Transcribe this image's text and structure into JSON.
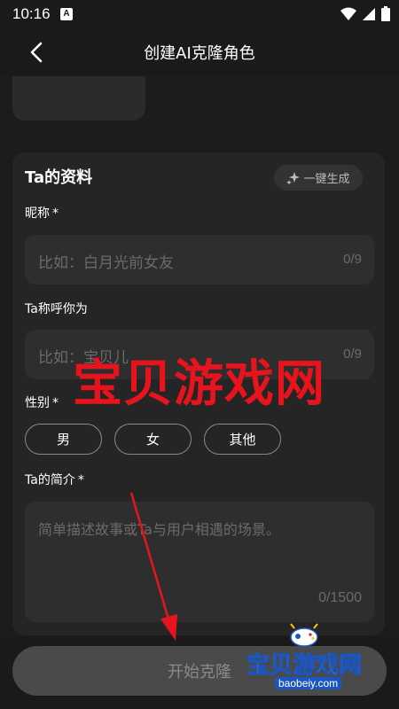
{
  "status_bar": {
    "time": "10:16",
    "notification_badge": "A"
  },
  "header": {
    "title": "创建AI克隆角色"
  },
  "profile": {
    "section_title": "Ta的资料",
    "ai_generate_label": "一键生成",
    "nickname": {
      "label": "昵称",
      "required_mark": "*",
      "placeholder": "比如：白月光前女友",
      "counter": "0/9"
    },
    "call_you": {
      "label": "Ta称呼你为",
      "placeholder": "比如：宝贝儿",
      "counter": "0/9"
    },
    "gender": {
      "label": "性别",
      "required_mark": "*",
      "options": [
        "男",
        "女",
        "其他"
      ]
    },
    "intro": {
      "label": "Ta的简介",
      "required_mark": "*",
      "placeholder": "简单描述故事或Ta与用户相遇的场景。",
      "counter": "0/1500"
    }
  },
  "start_button_label": "开始克隆",
  "watermark": {
    "text": "宝贝游戏网",
    "logo_text": "宝贝游戏网",
    "logo_url": "baobeiy.com"
  },
  "colors": {
    "background": "#1c1c1c",
    "card": "#252525",
    "input": "#2e2e2e",
    "watermark_red": "#e8141d",
    "annotation_arrow": "#e8141d"
  }
}
